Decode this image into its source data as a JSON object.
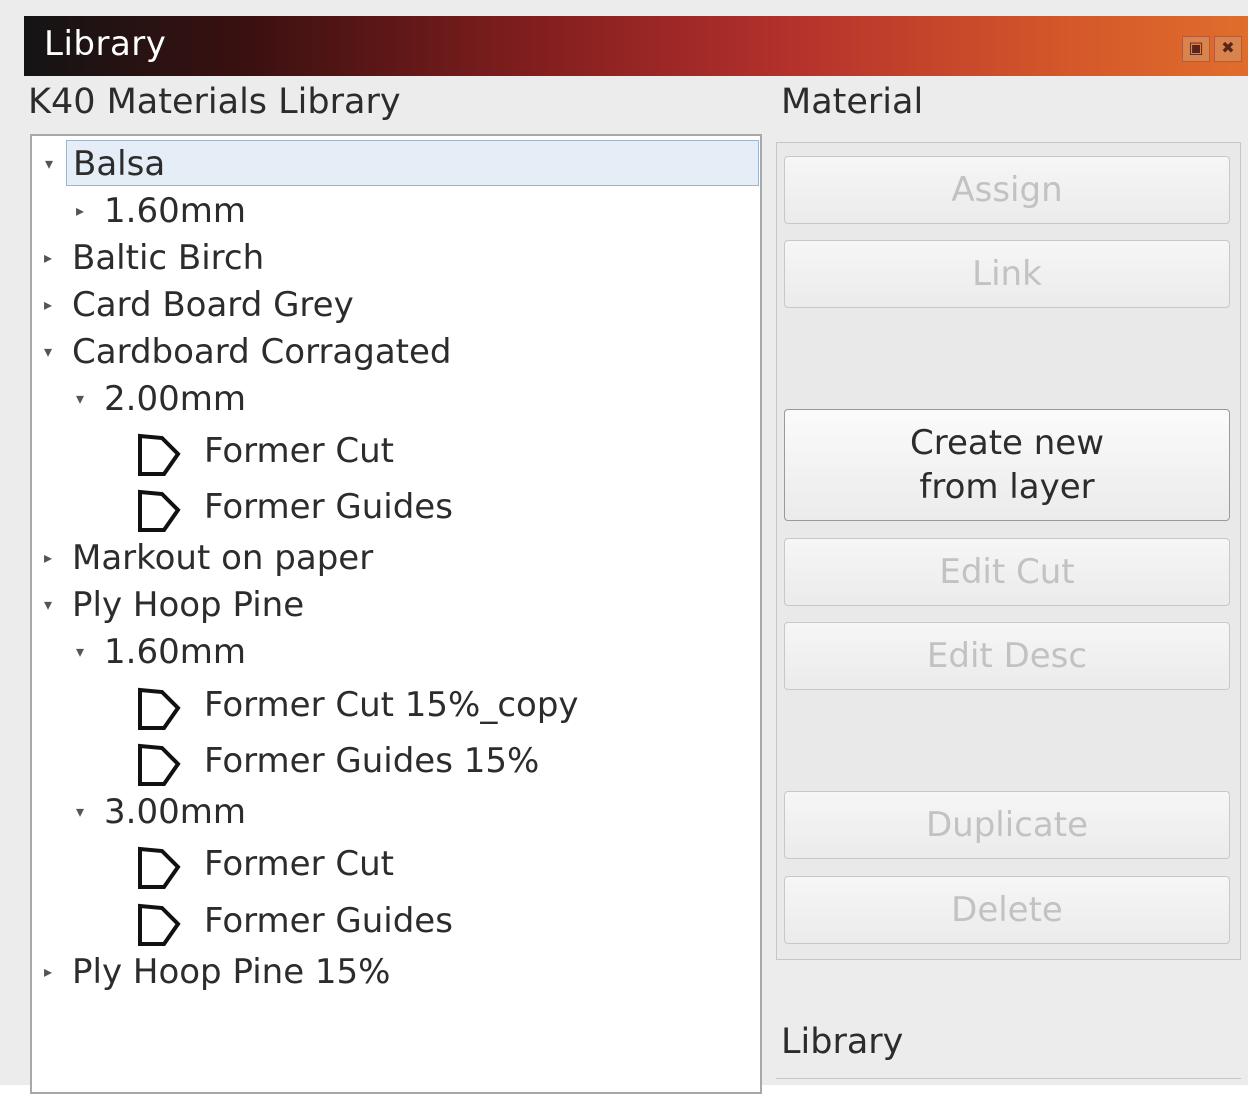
{
  "window": {
    "title": "Library",
    "controls": [
      "restore-icon",
      "close-icon"
    ]
  },
  "left_panel": {
    "label": "K40 Materials Library",
    "tree": [
      {
        "label": "Balsa",
        "expanded": true,
        "selected": true
      },
      {
        "label": "1.60mm",
        "expanded": false
      },
      {
        "label": "Baltic Birch",
        "expanded": false
      },
      {
        "label": "Card Board Grey",
        "expanded": false
      },
      {
        "label": "Cardboard Corragated",
        "expanded": true
      },
      {
        "label": "2.00mm",
        "expanded": true
      },
      {
        "label": "Former Cut",
        "icon": "pentagon-icon"
      },
      {
        "label": "Former Guides",
        "icon": "pentagon-icon"
      },
      {
        "label": "Markout on paper",
        "expanded": false
      },
      {
        "label": "Ply Hoop Pine",
        "expanded": true
      },
      {
        "label": "1.60mm",
        "expanded": true
      },
      {
        "label": "Former Cut 15%_copy",
        "icon": "pentagon-icon"
      },
      {
        "label": "Former Guides 15%",
        "icon": "pentagon-icon"
      },
      {
        "label": "3.00mm",
        "expanded": true
      },
      {
        "label": "Former Cut",
        "icon": "pentagon-icon"
      },
      {
        "label": "Former Guides",
        "icon": "pentagon-icon"
      },
      {
        "label": "Ply Hoop Pine 15%",
        "expanded": false
      }
    ]
  },
  "right_panel": {
    "material_label": "Material",
    "buttons": {
      "assign": "Assign",
      "link": "Link",
      "create_line1": "Create new",
      "create_line2": "from layer",
      "edit_cut": "Edit Cut",
      "edit_desc": "Edit Desc",
      "duplicate": "Duplicate",
      "delete": "Delete"
    },
    "library_label": "Library"
  }
}
